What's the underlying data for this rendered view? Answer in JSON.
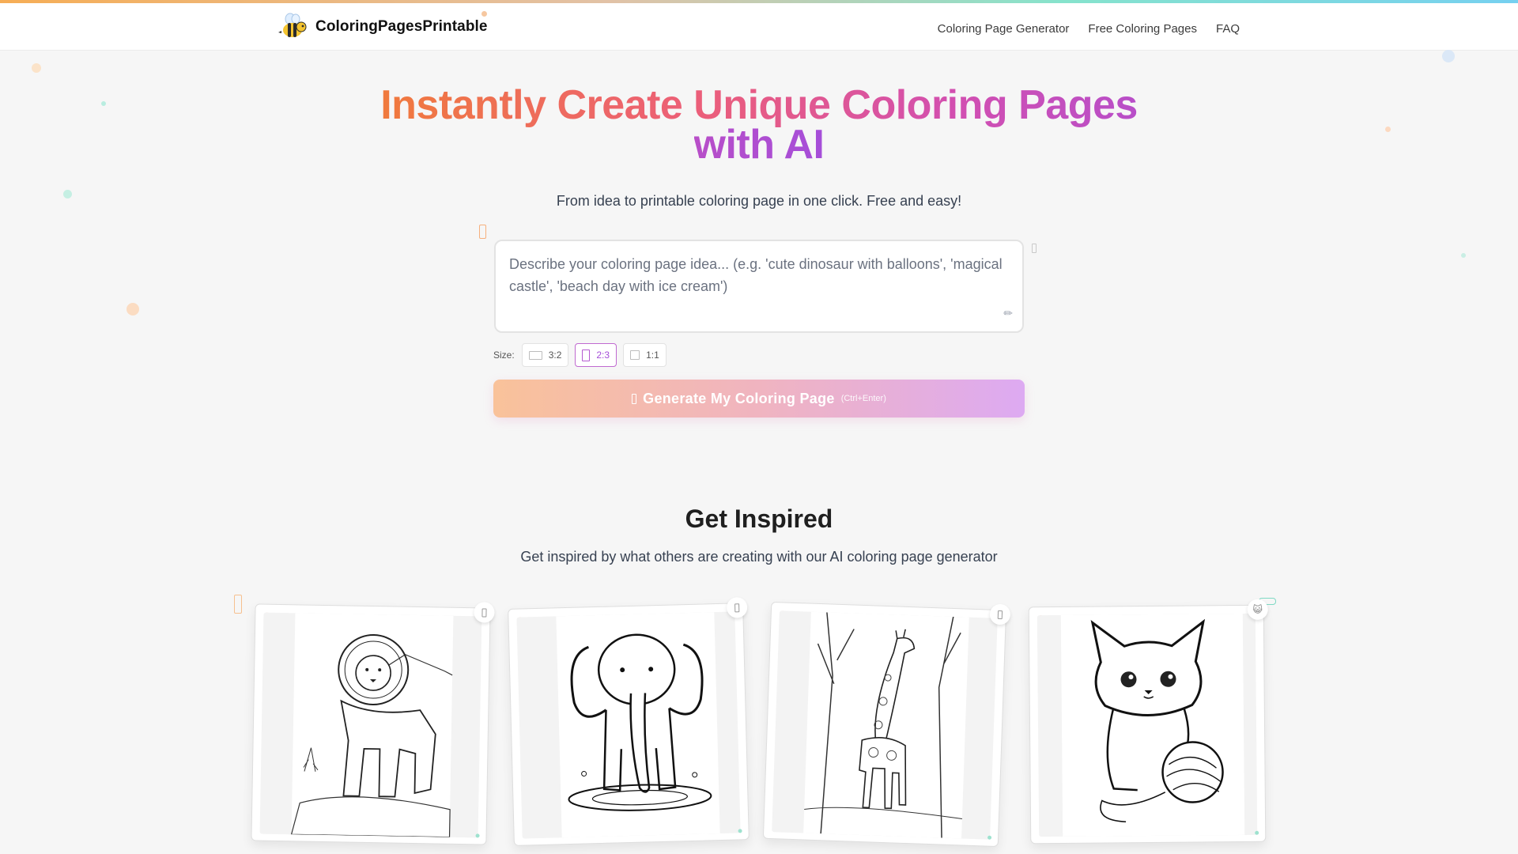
{
  "brand": {
    "name": "ColoringPagesPrintable",
    "logo_icon": "bee-icon"
  },
  "nav": {
    "items": [
      "Coloring Page Generator",
      "Free Coloring Pages",
      "FAQ"
    ]
  },
  "hero": {
    "title": "Instantly Create Unique Coloring Pages with AI",
    "subtitle": "From idea to printable coloring page in one click. Free and easy!"
  },
  "prompt": {
    "placeholder": "Describe your coloring page idea... (e.g. 'cute dinosaur with balloons', 'magical castle', 'beach day with ice cream')",
    "value": ""
  },
  "size": {
    "label": "Size:",
    "options": [
      "3:2",
      "2:3",
      "1:1"
    ],
    "selected": "2:3"
  },
  "generate": {
    "label": "Generate My Coloring Page",
    "shortcut": "(Ctrl+Enter)"
  },
  "inspire": {
    "title": "Get Inspired",
    "subtitle": "Get inspired by what others are creating with our AI coloring page generator",
    "cards": [
      {
        "subject": "lion"
      },
      {
        "subject": "elephant"
      },
      {
        "subject": "giraffe"
      },
      {
        "subject": "kitten"
      }
    ]
  },
  "colors": {
    "accent_purple": "#a54ed9",
    "accent_orange": "#f07a3d",
    "accent_pink": "#ec5f78",
    "background": "#f6f6f6"
  }
}
